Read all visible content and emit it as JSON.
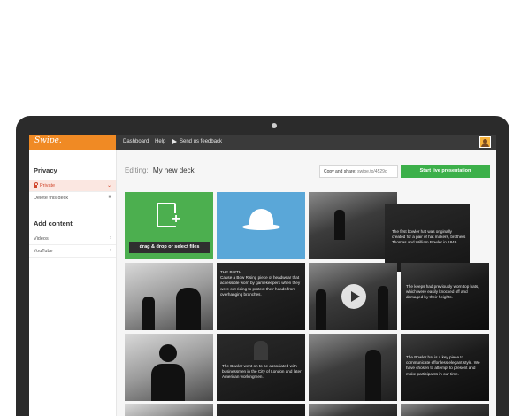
{
  "topbar": {
    "logo": "Swipe.",
    "nav": [
      "Dashboard",
      "Help"
    ],
    "feedback": "Send us feedback",
    "avatar_icon": "user-avatar"
  },
  "sidebar": {
    "privacy_heading": "Privacy",
    "private_label": "Private",
    "delete_label": "Delete this deck",
    "content_heading": "Add content",
    "videos_label": "Videos",
    "youtube_label": "YouTube"
  },
  "editor": {
    "editing_label": "Editing:",
    "deck_name": "My new deck",
    "share_label": "Copy and share:",
    "share_code": "swipe.to/4529d",
    "live_button": "Start live presentation"
  },
  "tiles": {
    "drop_label": "drag & drop or select files",
    "cap_1": "The first bowler hat was originally created for a pair of hat makers, brothers Thomas and William Bowler in 1849.",
    "cap_2_title": "THE BIRTH",
    "cap_2": "Cause a Bow Rising piece of headwear that accessible worn by gamekeepers when they were out riding to protect their heads from overhanging branches.",
    "cap_3": "The keeps had previously worn top hats, which were easily knocked off and damaged by their heights.",
    "cap_4": "The Bowler went on to be associated with businessmen in the City of London and later American workingmen.",
    "cap_5": "The Bowler hat is a key piece to communicate effortless elegant style. We have chosen to attempt to present and make participants in our time."
  },
  "colors": {
    "accent_orange": "#f08a24",
    "action_green": "#3cb04a",
    "tile_blue": "#5aa7d8",
    "private_red": "#d0452a"
  }
}
